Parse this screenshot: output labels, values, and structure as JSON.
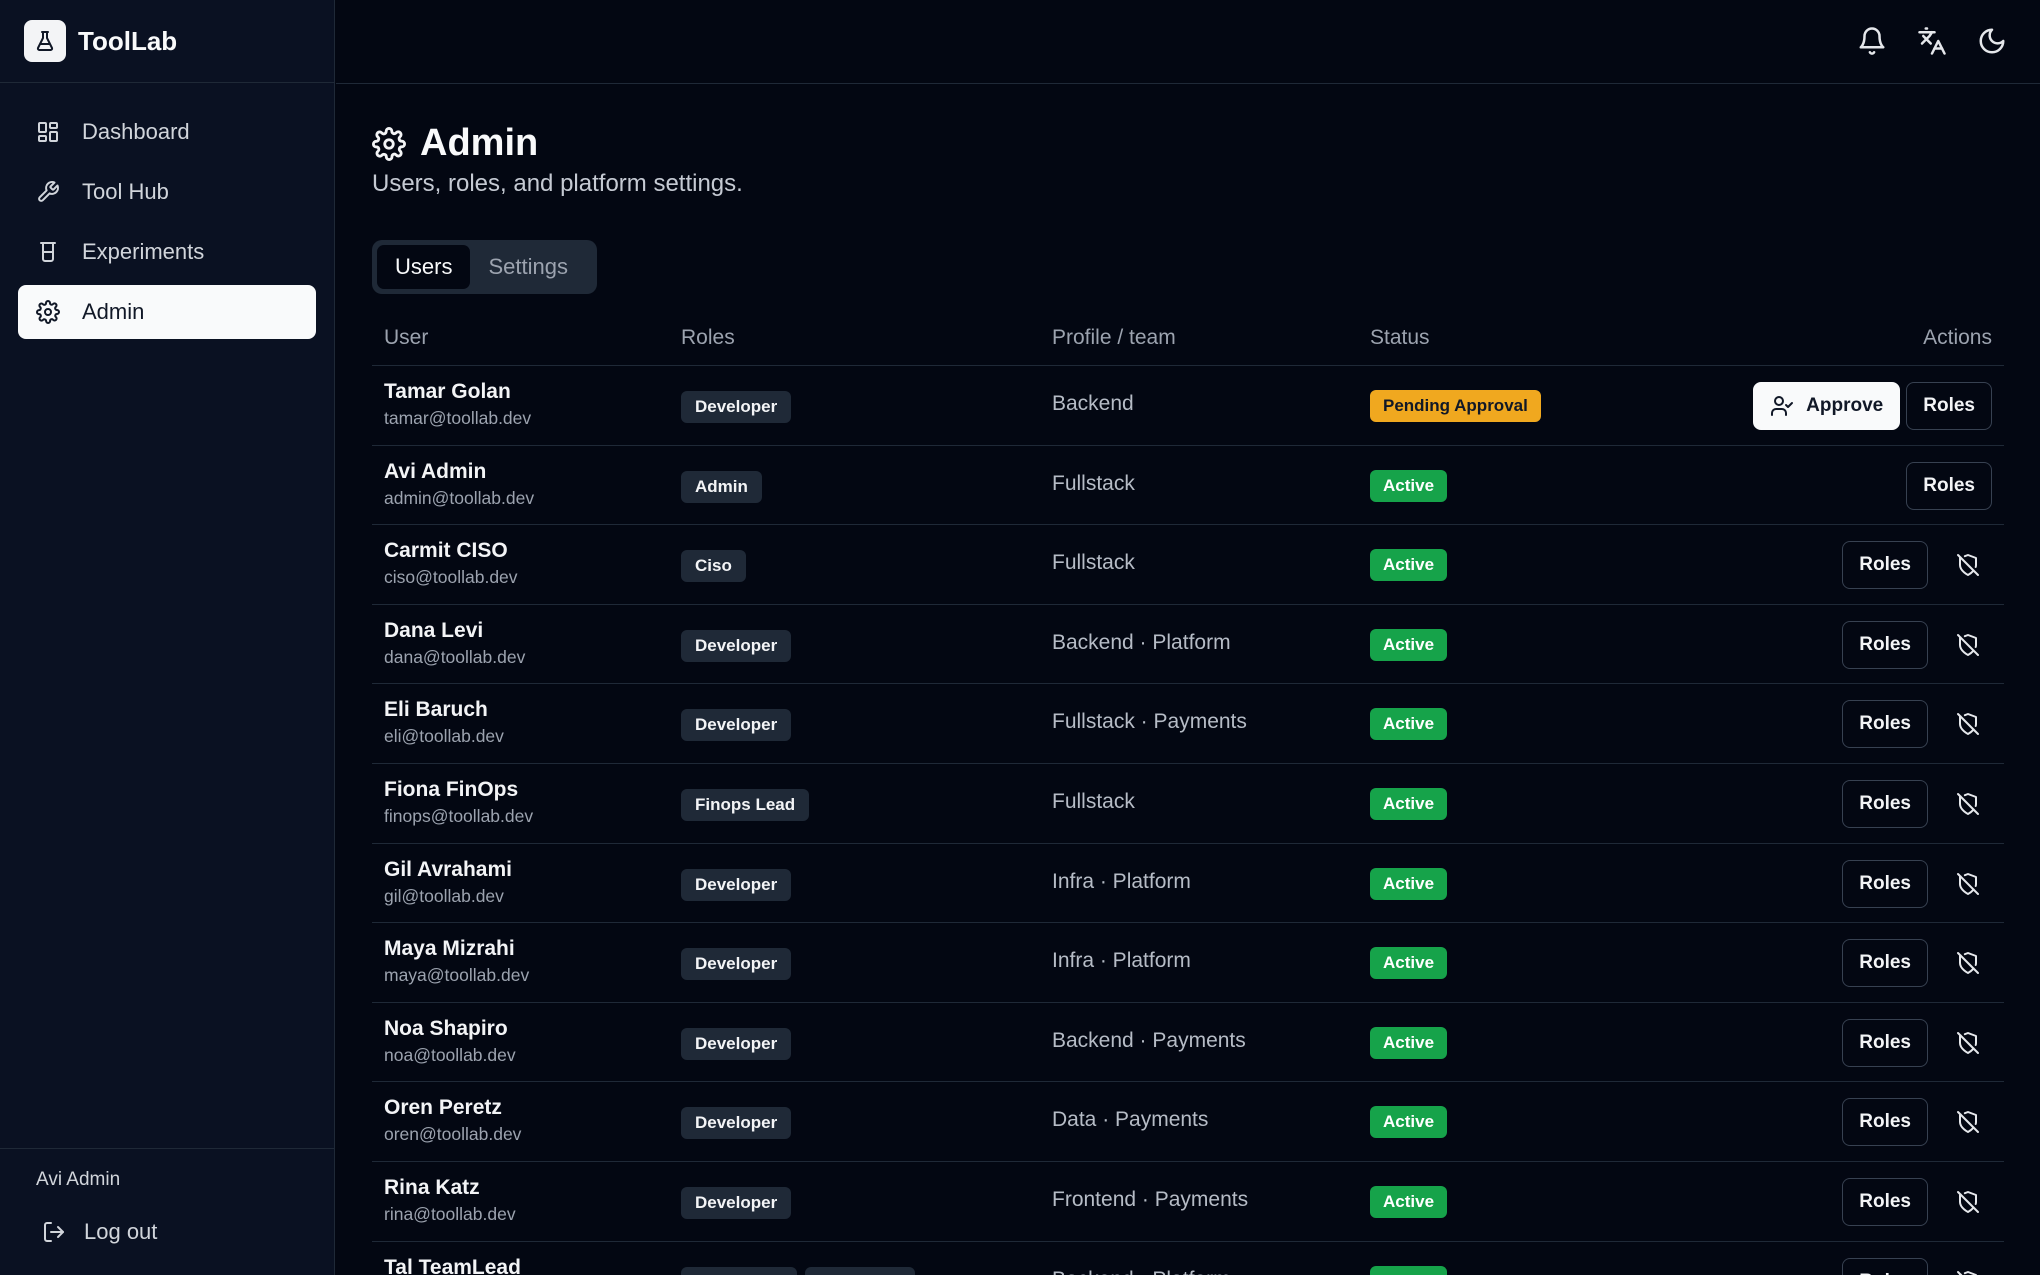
{
  "brand": {
    "name": "ToolLab",
    "icon": "flask-icon"
  },
  "sidebar": {
    "items": [
      {
        "label": "Dashboard",
        "icon": "dashboard-icon"
      },
      {
        "label": "Tool Hub",
        "icon": "wrench-icon"
      },
      {
        "label": "Experiments",
        "icon": "beaker-icon"
      },
      {
        "label": "Admin",
        "icon": "gear-icon",
        "active": true
      }
    ],
    "user": "Avi Admin",
    "logout_label": "Log out"
  },
  "topbar": {
    "icons": [
      "bell-icon",
      "translate-icon",
      "moon-icon"
    ]
  },
  "page": {
    "title": "Admin",
    "subtitle": "Users, roles, and platform settings.",
    "tabs": [
      {
        "label": "Users",
        "active": true
      },
      {
        "label": "Settings"
      }
    ]
  },
  "table": {
    "headers": {
      "user": "User",
      "roles": "Roles",
      "team": "Profile / team",
      "status": "Status",
      "actions": "Actions"
    },
    "rows": [
      {
        "name": "Tamar Golan",
        "email": "tamar@toollab.dev",
        "roles": [
          "Developer"
        ],
        "team": "Backend",
        "status": "Pending Approval",
        "status_type": "pending",
        "approve": "Approve",
        "roles_btn": "Roles",
        "revoke": false
      },
      {
        "name": "Avi Admin",
        "email": "admin@toollab.dev",
        "roles": [
          "Admin"
        ],
        "team": "Fullstack",
        "status": "Active",
        "status_type": "active",
        "roles_btn": "Roles",
        "revoke": false
      },
      {
        "name": "Carmit CISO",
        "email": "ciso@toollab.dev",
        "roles": [
          "Ciso"
        ],
        "team": "Fullstack",
        "status": "Active",
        "status_type": "active",
        "roles_btn": "Roles",
        "revoke": true
      },
      {
        "name": "Dana Levi",
        "email": "dana@toollab.dev",
        "roles": [
          "Developer"
        ],
        "team": "Backend · Platform",
        "status": "Active",
        "status_type": "active",
        "roles_btn": "Roles",
        "revoke": true
      },
      {
        "name": "Eli Baruch",
        "email": "eli@toollab.dev",
        "roles": [
          "Developer"
        ],
        "team": "Fullstack · Payments",
        "status": "Active",
        "status_type": "active",
        "roles_btn": "Roles",
        "revoke": true
      },
      {
        "name": "Fiona FinOps",
        "email": "finops@toollab.dev",
        "roles": [
          "Finops Lead"
        ],
        "team": "Fullstack",
        "status": "Active",
        "status_type": "active",
        "roles_btn": "Roles",
        "revoke": true
      },
      {
        "name": "Gil Avrahami",
        "email": "gil@toollab.dev",
        "roles": [
          "Developer"
        ],
        "team": "Infra · Platform",
        "status": "Active",
        "status_type": "active",
        "roles_btn": "Roles",
        "revoke": true
      },
      {
        "name": "Maya Mizrahi",
        "email": "maya@toollab.dev",
        "roles": [
          "Developer"
        ],
        "team": "Infra · Platform",
        "status": "Active",
        "status_type": "active",
        "roles_btn": "Roles",
        "revoke": true
      },
      {
        "name": "Noa Shapiro",
        "email": "noa@toollab.dev",
        "roles": [
          "Developer"
        ],
        "team": "Backend · Payments",
        "status": "Active",
        "status_type": "active",
        "roles_btn": "Roles",
        "revoke": true
      },
      {
        "name": "Oren Peretz",
        "email": "oren@toollab.dev",
        "roles": [
          "Developer"
        ],
        "team": "Data · Payments",
        "status": "Active",
        "status_type": "active",
        "roles_btn": "Roles",
        "revoke": true
      },
      {
        "name": "Rina Katz",
        "email": "rina@toollab.dev",
        "roles": [
          "Developer"
        ],
        "team": "Frontend · Payments",
        "status": "Active",
        "status_type": "active",
        "roles_btn": "Roles",
        "revoke": true
      },
      {
        "name": "Tal TeamLead",
        "email": "",
        "roles": [
          "Team Lead",
          "Developer"
        ],
        "team": "Backend · Platform",
        "status": "Active",
        "status_type": "active",
        "roles_btn": "Roles",
        "revoke": true
      }
    ]
  }
}
